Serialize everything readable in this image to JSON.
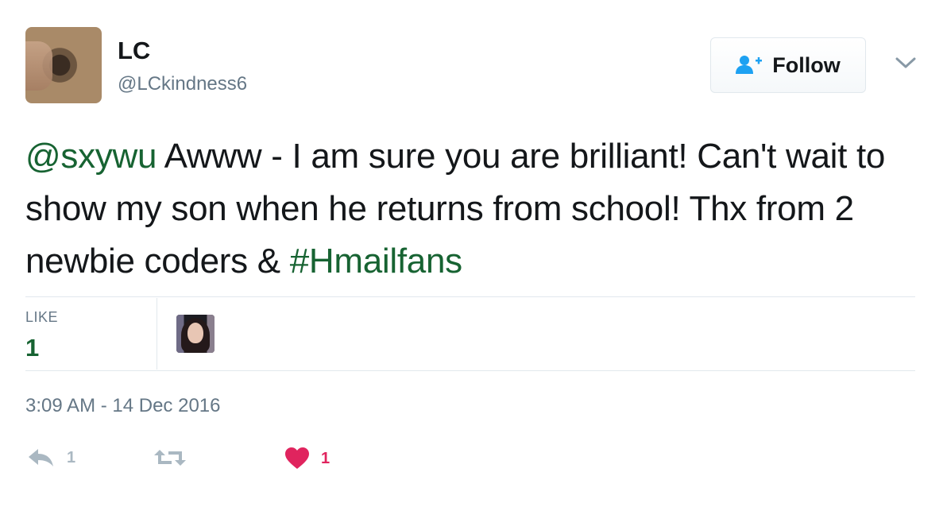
{
  "user": {
    "name": "LC",
    "handle": "@LCkindness6"
  },
  "follow": {
    "label": "Follow"
  },
  "tweet": {
    "mention": "@sxywu",
    "text_part1": " Awww - I am sure you are brilliant! Can't wait to show my son when he returns from school! Thx from 2 newbie coders & ",
    "hashtag": "#Hmailfans"
  },
  "stats": {
    "like_label": "LIKE",
    "like_count": "1"
  },
  "timestamp": "3:09 AM - 14 Dec 2016",
  "actions": {
    "reply_count": "1",
    "retweet_count": "",
    "like_count": "1"
  },
  "colors": {
    "link": "#176332",
    "muted": "#657786",
    "like": "#e0245e",
    "icon": "#aab8c2",
    "follow_icon": "#1da1f2"
  },
  "icons": {
    "follow": "add-user-icon",
    "menu": "chevron-down-icon",
    "reply": "reply-icon",
    "retweet": "retweet-icon",
    "like": "heart-icon"
  }
}
